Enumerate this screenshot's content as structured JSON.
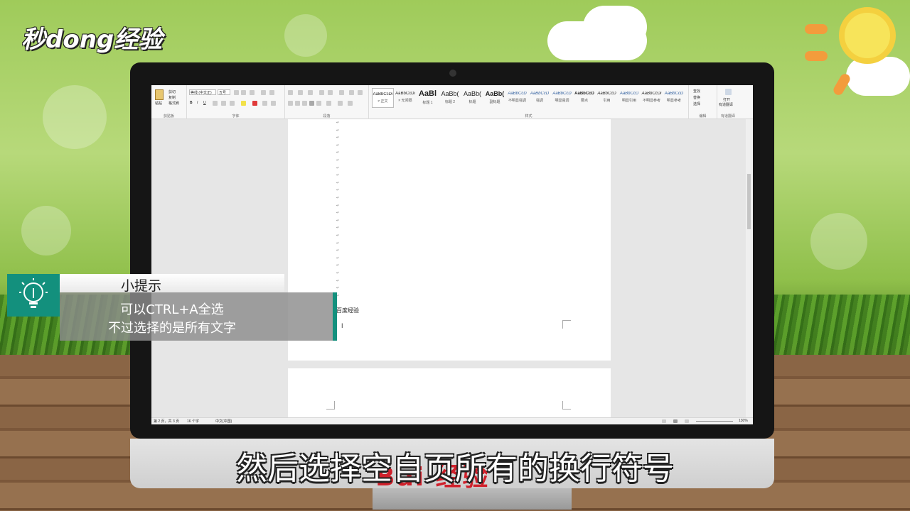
{
  "video": {
    "logo_text": "秒dong经验",
    "subtitle": "然后选择空自页所有的换行符号",
    "monitor_brand": "Bai 经验",
    "tip": {
      "title": "小提示",
      "line1": "可以CTRL+A全选",
      "line2": "不过选择的是所有文字"
    }
  },
  "word": {
    "ribbon": {
      "clipboard": {
        "paste": "粘贴",
        "cut": "剪切",
        "copy": "复制",
        "format_painter": "格式刷",
        "label": "剪贴板"
      },
      "font": {
        "font_name": "等线 (中文正)",
        "font_size": "五号",
        "label": "字体"
      },
      "paragraph": {
        "label": "段落"
      },
      "styles": {
        "label": "样式",
        "items": [
          {
            "sample": "AaBbCcDi",
            "name": "≠ 正文"
          },
          {
            "sample": "AaBbCcDi",
            "name": "≠ 无间隔"
          },
          {
            "sample": "AaBl",
            "name": "标题 1"
          },
          {
            "sample": "AaBb(",
            "name": "标题 2"
          },
          {
            "sample": "AaBb(",
            "name": "标题"
          },
          {
            "sample": "AaBb(",
            "name": "副标题"
          },
          {
            "sample": "AaBbCcD",
            "name": "不明显强调"
          },
          {
            "sample": "AaBbCcD",
            "name": "强调"
          },
          {
            "sample": "AaBbCcD",
            "name": "明显强调"
          },
          {
            "sample": "AaBbCcD",
            "name": "要点"
          },
          {
            "sample": "AaBbCcD",
            "name": "引用"
          },
          {
            "sample": "AaBbCcD",
            "name": "明显引用"
          },
          {
            "sample": "AaBbCcDi",
            "name": "不明显参考"
          },
          {
            "sample": "AaBbCcD",
            "name": "明显参考"
          }
        ]
      },
      "editing": {
        "find": "查找",
        "replace": "替换",
        "select": "选择",
        "label": "编辑"
      },
      "translate": {
        "btn_line1": "打开",
        "btn_line2": "有道翻译",
        "label": "有道翻译"
      }
    },
    "document": {
      "paragraph_mark": "↵",
      "text": "百度经验"
    },
    "status": {
      "page": "第 2 页，共 3 页",
      "words": "16 个字",
      "language": "中文(中国)",
      "zoom": "130%"
    }
  }
}
